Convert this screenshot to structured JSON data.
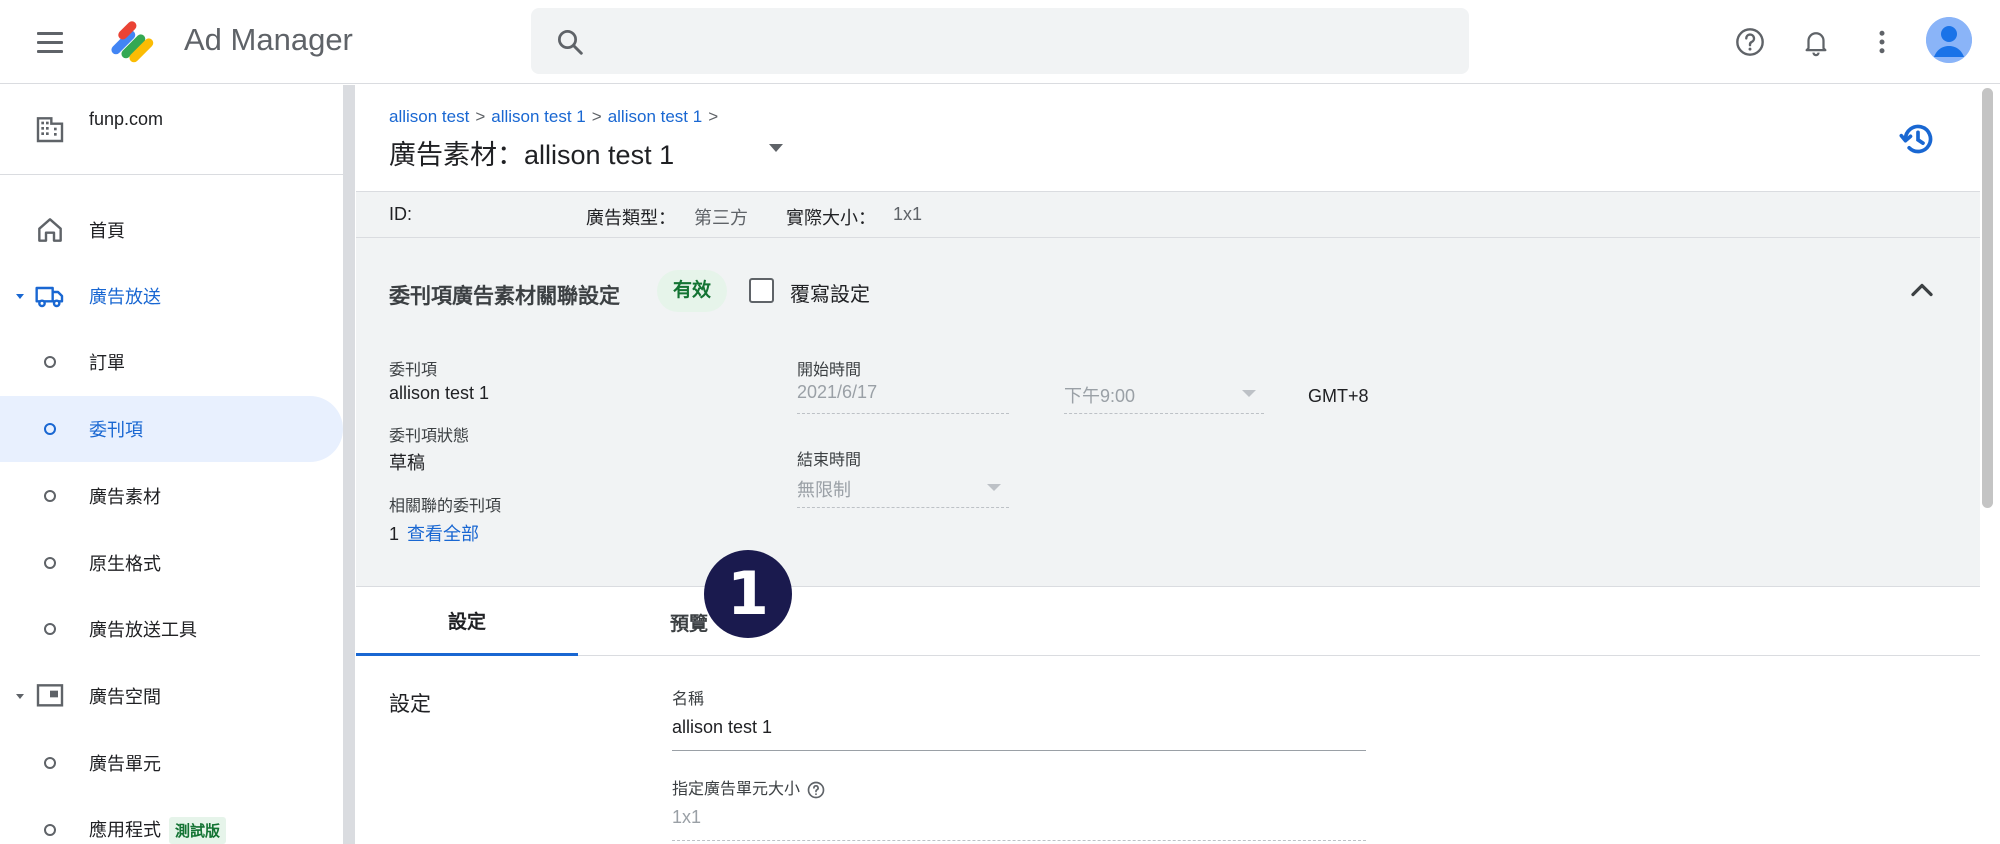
{
  "header": {
    "app_title": "Ad Manager",
    "icons": [
      "menu-icon",
      "ad-manager-logo",
      "search-icon",
      "help-icon",
      "bell-icon",
      "more-vert-icon",
      "avatar"
    ]
  },
  "sidebar": {
    "network": "funp.com",
    "items": [
      {
        "label": "首頁"
      },
      {
        "label": "廣告放送"
      },
      {
        "label": "訂單"
      },
      {
        "label": "委刊項"
      },
      {
        "label": "廣告素材"
      },
      {
        "label": "原生格式"
      },
      {
        "label": "廣告放送工具"
      },
      {
        "label": "廣告空間"
      },
      {
        "label": "廣告單元"
      },
      {
        "label": "應用程式",
        "badge": "測試版"
      }
    ]
  },
  "main": {
    "breadcrumbs": [
      "allison test",
      "allison test 1",
      "allison test 1"
    ],
    "title": "廣告素材：allison test 1",
    "id_row": {
      "id_label": "ID:",
      "type_label": "廣告類型：",
      "type_value": "第三方",
      "size_label": "實際大小：",
      "size_value": "1x1"
    },
    "association": {
      "title": "委刊項廣告素材關聯設定",
      "status": "有效",
      "override_label": "覆寫設定",
      "line_item_label": "委刊項",
      "line_item_value": "allison test 1",
      "line_item_status_label": "委刊項狀態",
      "line_item_status_value": "草稿",
      "related_label": "相關聯的委刊項",
      "related_count": "1",
      "view_all": "查看全部",
      "start_label": "開始時間",
      "start_date": "2021/6/17",
      "start_time": "下午9:00",
      "timezone": "GMT+8",
      "end_label": "結束時間",
      "end_value": "無限制"
    },
    "tabs": [
      "設定",
      "預覽"
    ],
    "marker": "1",
    "settings": {
      "section_title": "設定",
      "name_label": "名稱",
      "name_value": "allison test 1",
      "size_label": "指定廣告單元大小",
      "size_value": "1x1"
    }
  },
  "colors": {
    "accent": "#1967d2",
    "status_green": "#137333",
    "status_bg": "#e6f4ea",
    "panel_gray": "#f1f3f4"
  }
}
